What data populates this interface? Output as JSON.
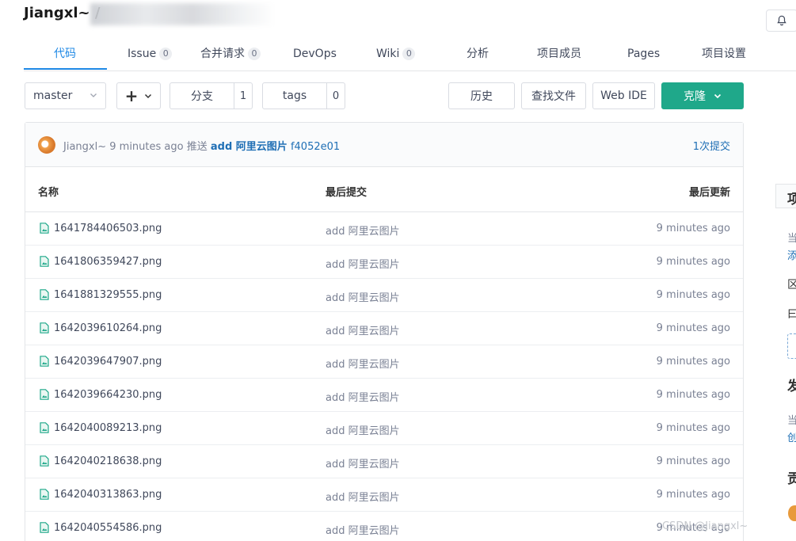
{
  "header": {
    "repo_title": "Jiangxl~ /"
  },
  "icons": {
    "bell": "bell-icon",
    "file": "image-file-icon"
  },
  "colors": {
    "accent": "#1e88e5",
    "clone": "#1fa88a",
    "link": "#1f6fb5"
  },
  "tabs": [
    {
      "label": "代码",
      "count": ""
    },
    {
      "label": "Issue",
      "count": "0"
    },
    {
      "label": "合并请求",
      "count": "0"
    },
    {
      "label": "DevOps",
      "count": ""
    },
    {
      "label": "Wiki",
      "count": "0"
    },
    {
      "label": "分析",
      "count": ""
    },
    {
      "label": "项目成员",
      "count": ""
    },
    {
      "label": "Pages",
      "count": ""
    },
    {
      "label": "项目设置",
      "count": ""
    }
  ],
  "toolbar": {
    "branch": "master",
    "add_label": "+",
    "branches_label": "分支",
    "branches_count": "1",
    "tags_label": "tags",
    "tags_count": "0",
    "history_label": "历史",
    "find_label": "查找文件",
    "webide_label": "Web IDE",
    "clone_label": "克隆"
  },
  "commit": {
    "author": "Jiangxl~",
    "time": "9 minutes ago",
    "action": "推送",
    "message": "add 阿里云图片",
    "sha": "f4052e01",
    "count_label": "1次提交"
  },
  "table": {
    "headers": {
      "name": "名称",
      "last_commit": "最后提交",
      "last_update": "最后更新"
    },
    "rows": [
      {
        "name": "1641784406503.png",
        "commit": "add 阿里云图片",
        "time": "9 minutes ago"
      },
      {
        "name": "1641806359427.png",
        "commit": "add 阿里云图片",
        "time": "9 minutes ago"
      },
      {
        "name": "1641881329555.png",
        "commit": "add 阿里云图片",
        "time": "9 minutes ago"
      },
      {
        "name": "1642039610264.png",
        "commit": "add 阿里云图片",
        "time": "9 minutes ago"
      },
      {
        "name": "1642039647907.png",
        "commit": "add 阿里云图片",
        "time": "9 minutes ago"
      },
      {
        "name": "1642039664230.png",
        "commit": "add 阿里云图片",
        "time": "9 minutes ago"
      },
      {
        "name": "1642040089213.png",
        "commit": "add 阿里云图片",
        "time": "9 minutes ago"
      },
      {
        "name": "1642040218638.png",
        "commit": "add 阿里云图片",
        "time": "9 minutes ago"
      },
      {
        "name": "1642040313863.png",
        "commit": "add 阿里云图片",
        "time": "9 minutes ago"
      },
      {
        "name": "1642040554586.png",
        "commit": "add 阿里云图片",
        "time": "9 minutes ago"
      }
    ]
  },
  "sidebar": {
    "about_title": "项",
    "line1": "当",
    "line2": "添",
    "line3": "区",
    "line4": "曰",
    "releases_title": "发",
    "line5": "当",
    "line6": "创",
    "contributors_title": "贡"
  },
  "watermark": "CSDN @Jiangxl~"
}
